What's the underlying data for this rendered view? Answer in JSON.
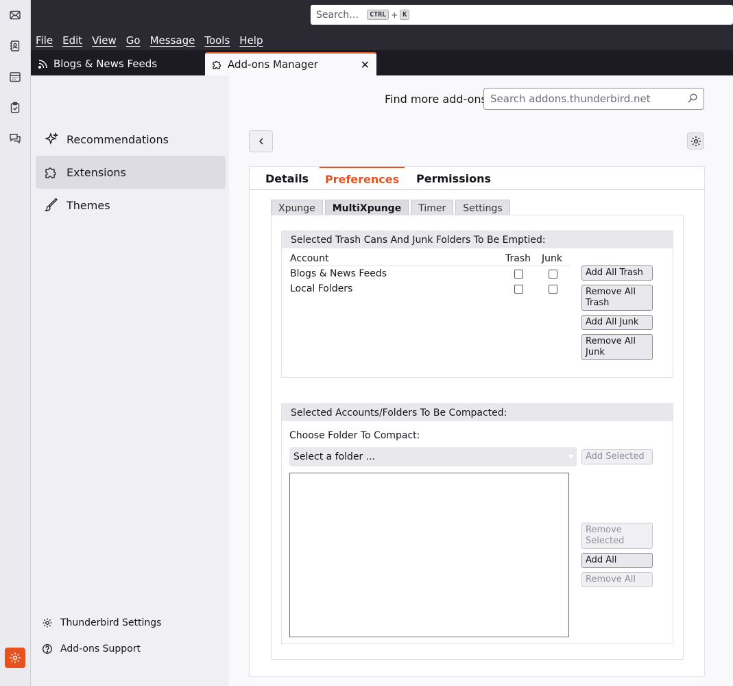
{
  "spaces": [
    "mail-icon",
    "address-book-icon",
    "calendar-icon",
    "tasks-icon",
    "chat-icon",
    "settings-icon"
  ],
  "search": {
    "placeholder": "Search…",
    "key1": "CTRL",
    "plus": "+",
    "key2": "K"
  },
  "menu": [
    "File",
    "Edit",
    "View",
    "Go",
    "Message",
    "Tools",
    "Help"
  ],
  "tabs": [
    {
      "label": "Blogs & News Feeds"
    },
    {
      "label": "Add-ons Manager",
      "close": "✕"
    }
  ],
  "sidebar": {
    "categories": [
      {
        "label": "Recommendations"
      },
      {
        "label": "Extensions",
        "selected": true
      },
      {
        "label": "Themes"
      }
    ],
    "footer": [
      {
        "label": "Thunderbird Settings"
      },
      {
        "label": "Add-ons Support"
      }
    ]
  },
  "header": {
    "find_label": "Find more add-ons",
    "find_placeholder": "Search addons.thunderbird.net"
  },
  "detail_tabs": [
    "Details",
    "Preferences",
    "Permissions"
  ],
  "active_detail_tab": "Preferences",
  "prefs_tabs": [
    "Xpunge",
    "MultiXpunge",
    "Timer",
    "Settings"
  ],
  "active_prefs_tab": "MultiXpunge",
  "trash_group": {
    "title": "Selected Trash Cans And Junk Folders To Be Emptied:",
    "col_account": "Account",
    "col_trash": "Trash",
    "col_junk": "Junk",
    "rows": [
      {
        "account": "Blogs & News Feeds",
        "trash": false,
        "junk": false
      },
      {
        "account": "Local Folders",
        "trash": false,
        "junk": false
      }
    ],
    "buttons": [
      "Add All Trash",
      "Remove All Trash",
      "Add All Junk",
      "Remove All Junk"
    ]
  },
  "compact_group": {
    "title": "Selected Accounts/Folders To Be Compacted:",
    "choose_label": "Choose Folder To Compact:",
    "select_value": "Select a folder ...",
    "add_selected": "Add Selected",
    "remove_selected": "Remove Selected",
    "add_all": "Add All",
    "remove_all": "Remove All"
  }
}
